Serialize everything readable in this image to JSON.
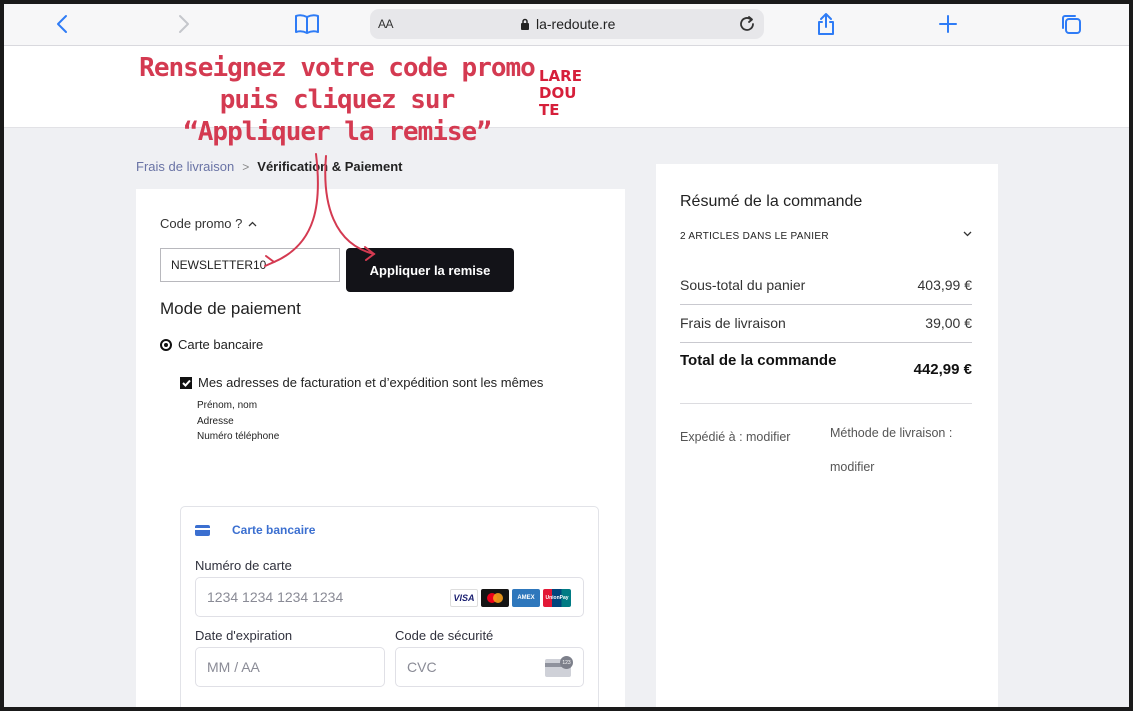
{
  "browser": {
    "text_size_label": "AA",
    "url": "la-redoute.re",
    "icons": [
      "back-icon",
      "forward-icon",
      "bookmarks-icon",
      "lock-icon",
      "reload-icon",
      "share-icon",
      "new-tab-icon",
      "tabs-icon"
    ]
  },
  "logo": {
    "lines": [
      "LARE",
      "DOU",
      "TE"
    ],
    "color": "#d61f3a"
  },
  "annotation": {
    "line1": "Renseignez votre code promo",
    "line2": "puis cliquez sur",
    "line3": "“Appliquer la remise”",
    "color": "#d43a51"
  },
  "breadcrumb": {
    "prev": "Frais de livraison",
    "separator": ">",
    "current": "Vérification & Paiement"
  },
  "checkout": {
    "promo_toggle": "Code promo ?",
    "promo_code_value": "NEWSLETTER10",
    "apply_button": "Appliquer la remise",
    "payment_mode_title": "Mode de paiement",
    "payment_option": "Carte bancaire",
    "same_address_label": "Mes adresses de facturation et d’expédition sont les mêmes",
    "address_lines": [
      "Prénom, nom",
      "Adresse",
      "Numéro téléphone"
    ]
  },
  "card_form": {
    "tab_label": "Carte bancaire",
    "card_number_label": "Numéro de carte",
    "card_number_placeholder": "1234 1234 1234 1234",
    "brands": [
      "VISA",
      "Mastercard",
      "AMEX",
      "UnionPay"
    ],
    "expiry_label": "Date d'expiration",
    "expiry_placeholder": "MM / AA",
    "cvc_label": "Code de sécurité",
    "cvc_placeholder": "CVC",
    "accent": "#3b6fd0"
  },
  "summary": {
    "title": "Résumé de la commande",
    "articles": "2 ARTICLES DANS LE PANIER",
    "subtotal_label": "Sous-total du panier",
    "subtotal_value": "403,99 €",
    "shipping_label": "Frais de livraison",
    "shipping_value": "39,00 €",
    "total_label": "Total de la commande",
    "total_value": "442,99 €",
    "shipped_to": "Expédié à : modifier",
    "delivery_method_line1": "Méthode de livraison :",
    "delivery_method_line2": "modifier"
  }
}
